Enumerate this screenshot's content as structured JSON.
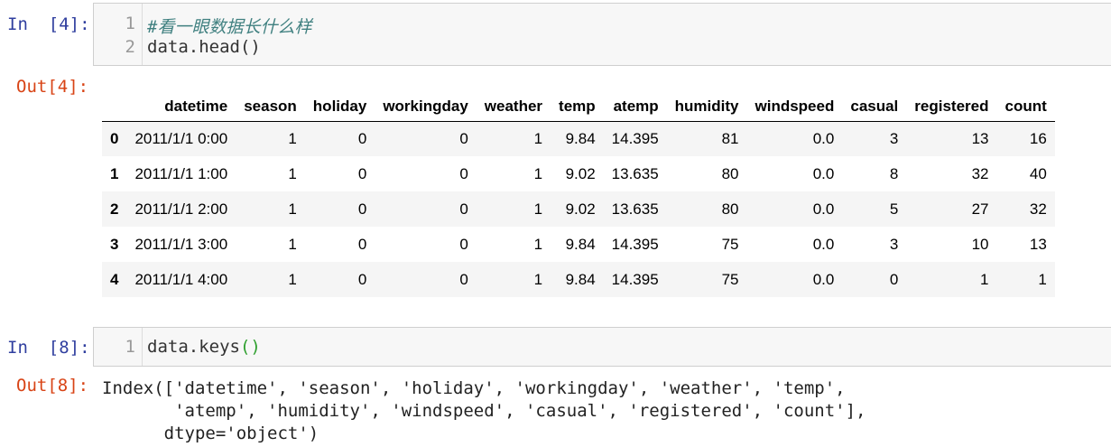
{
  "cell1": {
    "in_prompt": "In  [4]:",
    "code_lines": [
      {
        "num": "1",
        "text": "#看一眼数据长什么样"
      },
      {
        "num": "2",
        "text": "data.head()"
      }
    ],
    "out_prompt": "Out[4]:",
    "table": {
      "columns": [
        "",
        "datetime",
        "season",
        "holiday",
        "workingday",
        "weather",
        "temp",
        "atemp",
        "humidity",
        "windspeed",
        "casual",
        "registered",
        "count"
      ],
      "rows": [
        {
          "index": "0",
          "cells": [
            "2011/1/1 0:00",
            "1",
            "0",
            "0",
            "1",
            "9.84",
            "14.395",
            "81",
            "0.0",
            "3",
            "13",
            "16"
          ]
        },
        {
          "index": "1",
          "cells": [
            "2011/1/1 1:00",
            "1",
            "0",
            "0",
            "1",
            "9.02",
            "13.635",
            "80",
            "0.0",
            "8",
            "32",
            "40"
          ]
        },
        {
          "index": "2",
          "cells": [
            "2011/1/1 2:00",
            "1",
            "0",
            "0",
            "1",
            "9.02",
            "13.635",
            "80",
            "0.0",
            "5",
            "27",
            "32"
          ]
        },
        {
          "index": "3",
          "cells": [
            "2011/1/1 3:00",
            "1",
            "0",
            "0",
            "1",
            "9.84",
            "14.395",
            "75",
            "0.0",
            "3",
            "10",
            "13"
          ]
        },
        {
          "index": "4",
          "cells": [
            "2011/1/1 4:00",
            "1",
            "0",
            "0",
            "1",
            "9.84",
            "14.395",
            "75",
            "0.0",
            "0",
            "1",
            "1"
          ]
        }
      ]
    }
  },
  "cell2": {
    "in_prompt": "In  [8]:",
    "code_lines": [
      {
        "num": "1",
        "text_main": "data.keys",
        "text_parens": "()"
      }
    ],
    "out_prompt": "Out[8]:",
    "output_lines": [
      "Index(['datetime', 'season', 'holiday', 'workingday', 'weather', 'temp',",
      "       'atemp', 'humidity', 'windspeed', 'casual', 'registered', 'count'],",
      "      dtype='object')"
    ]
  }
}
